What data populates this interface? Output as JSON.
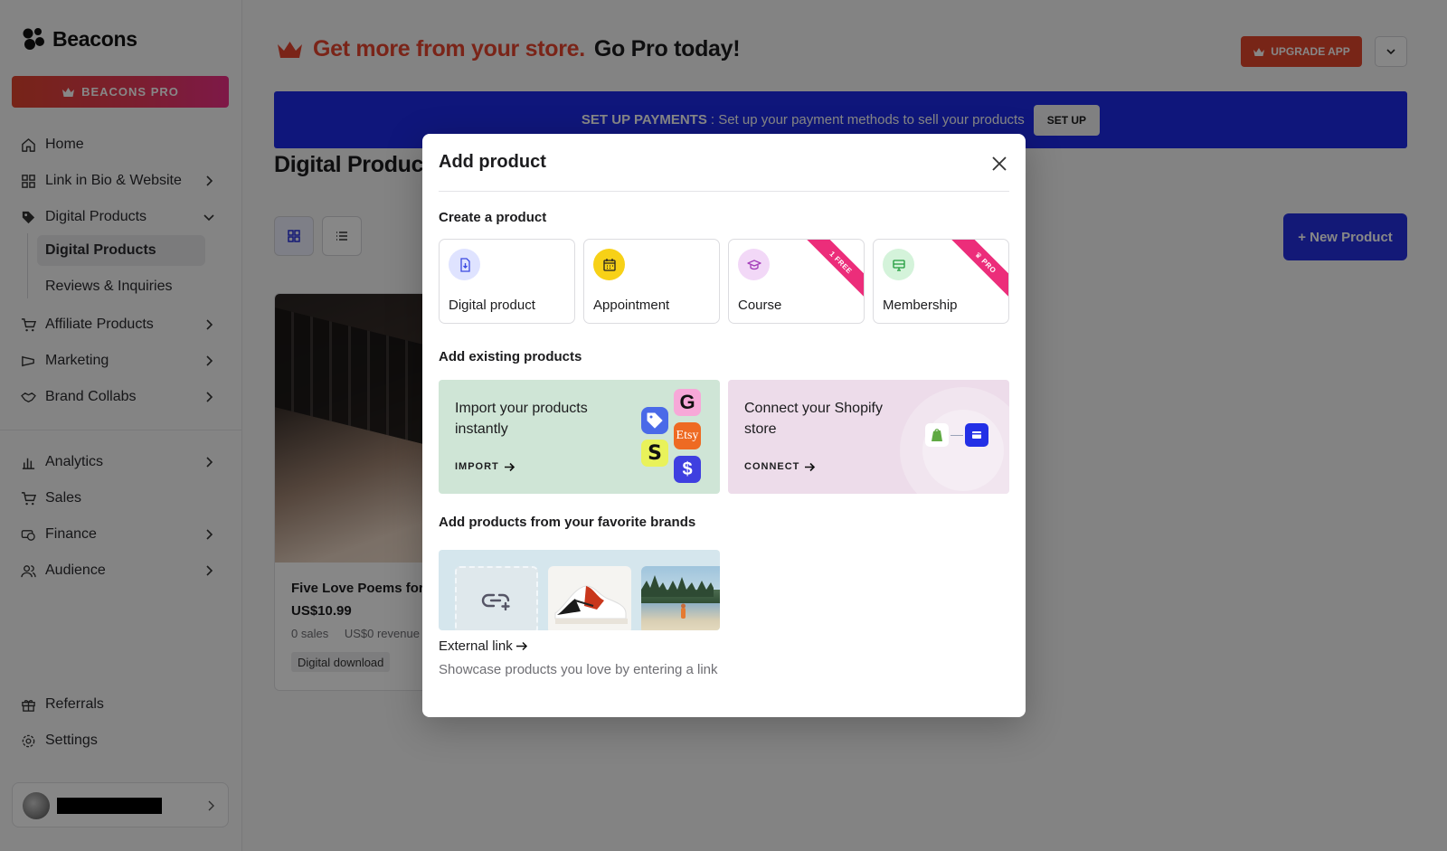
{
  "brand": {
    "name": "Beacons",
    "pro_label": "BEACONS PRO"
  },
  "sidebar": {
    "items": [
      {
        "label": "Home",
        "icon": "home-icon"
      },
      {
        "label": "Link in Bio & Website",
        "icon": "grid-icon"
      },
      {
        "label": "Digital Products",
        "icon": "tag-icon"
      },
      {
        "label": "Affiliate Products",
        "icon": "cart-icon"
      },
      {
        "label": "Marketing",
        "icon": "megaphone-icon"
      },
      {
        "label": "Brand Collabs",
        "icon": "handshake-icon"
      },
      {
        "label": "Analytics",
        "icon": "bar-chart-icon"
      },
      {
        "label": "Sales",
        "icon": "cart-icon"
      },
      {
        "label": "Finance",
        "icon": "money-icon"
      },
      {
        "label": "Audience",
        "icon": "users-icon"
      },
      {
        "label": "Referrals",
        "icon": "gift-icon"
      },
      {
        "label": "Settings",
        "icon": "gear-icon"
      }
    ],
    "sub_items": [
      {
        "label": "Digital Products",
        "active": true
      },
      {
        "label": "Reviews & Inquiries",
        "active": false
      }
    ],
    "account_name": "████████"
  },
  "header": {
    "promo_accent": "Get more from your store.",
    "promo_rest": "Go Pro today!",
    "upgrade_label": "UPGRADE APP"
  },
  "payments_banner": {
    "bold": "SET UP PAYMENTS",
    "text": ": Set up your payment methods to sell your products",
    "button": "SET UP"
  },
  "page": {
    "title": "Digital Products",
    "new_product": "+ New Product"
  },
  "product": {
    "name": "Five Love Poems for",
    "price": "US$10.99",
    "sales": "0 sales",
    "revenue": "US$0 revenue",
    "tag": "Digital download"
  },
  "modal": {
    "title": "Add product",
    "create_title": "Create a product",
    "types": [
      {
        "label": "Digital product",
        "icon": "digital-file-icon",
        "ribbon": ""
      },
      {
        "label": "Appointment",
        "icon": "calendar-icon",
        "ribbon": ""
      },
      {
        "label": "Course",
        "icon": "graduation-cap-icon",
        "ribbon": "1 FREE"
      },
      {
        "label": "Membership",
        "icon": "monitor-icon",
        "ribbon": "♛ PRO"
      }
    ],
    "existing_title": "Add existing products",
    "import": {
      "text": "Import your products instantly",
      "cta": "IMPORT"
    },
    "connect": {
      "text": "Connect your Shopify store",
      "cta": "CONNECT"
    },
    "import_apps": {
      "g": "G",
      "etsy": "Etsy",
      "s": "S",
      "dollar": "$"
    },
    "brands_title": "Add products from your favorite brands",
    "external": {
      "title": "External link",
      "desc": "Showcase products you love by entering a link"
    }
  },
  "colors": {
    "accent_red": "#e6452f",
    "primary_blue": "#2430e0",
    "banner_blue": "#1e2be8",
    "ribbon_pink": "#ec2d7a"
  }
}
